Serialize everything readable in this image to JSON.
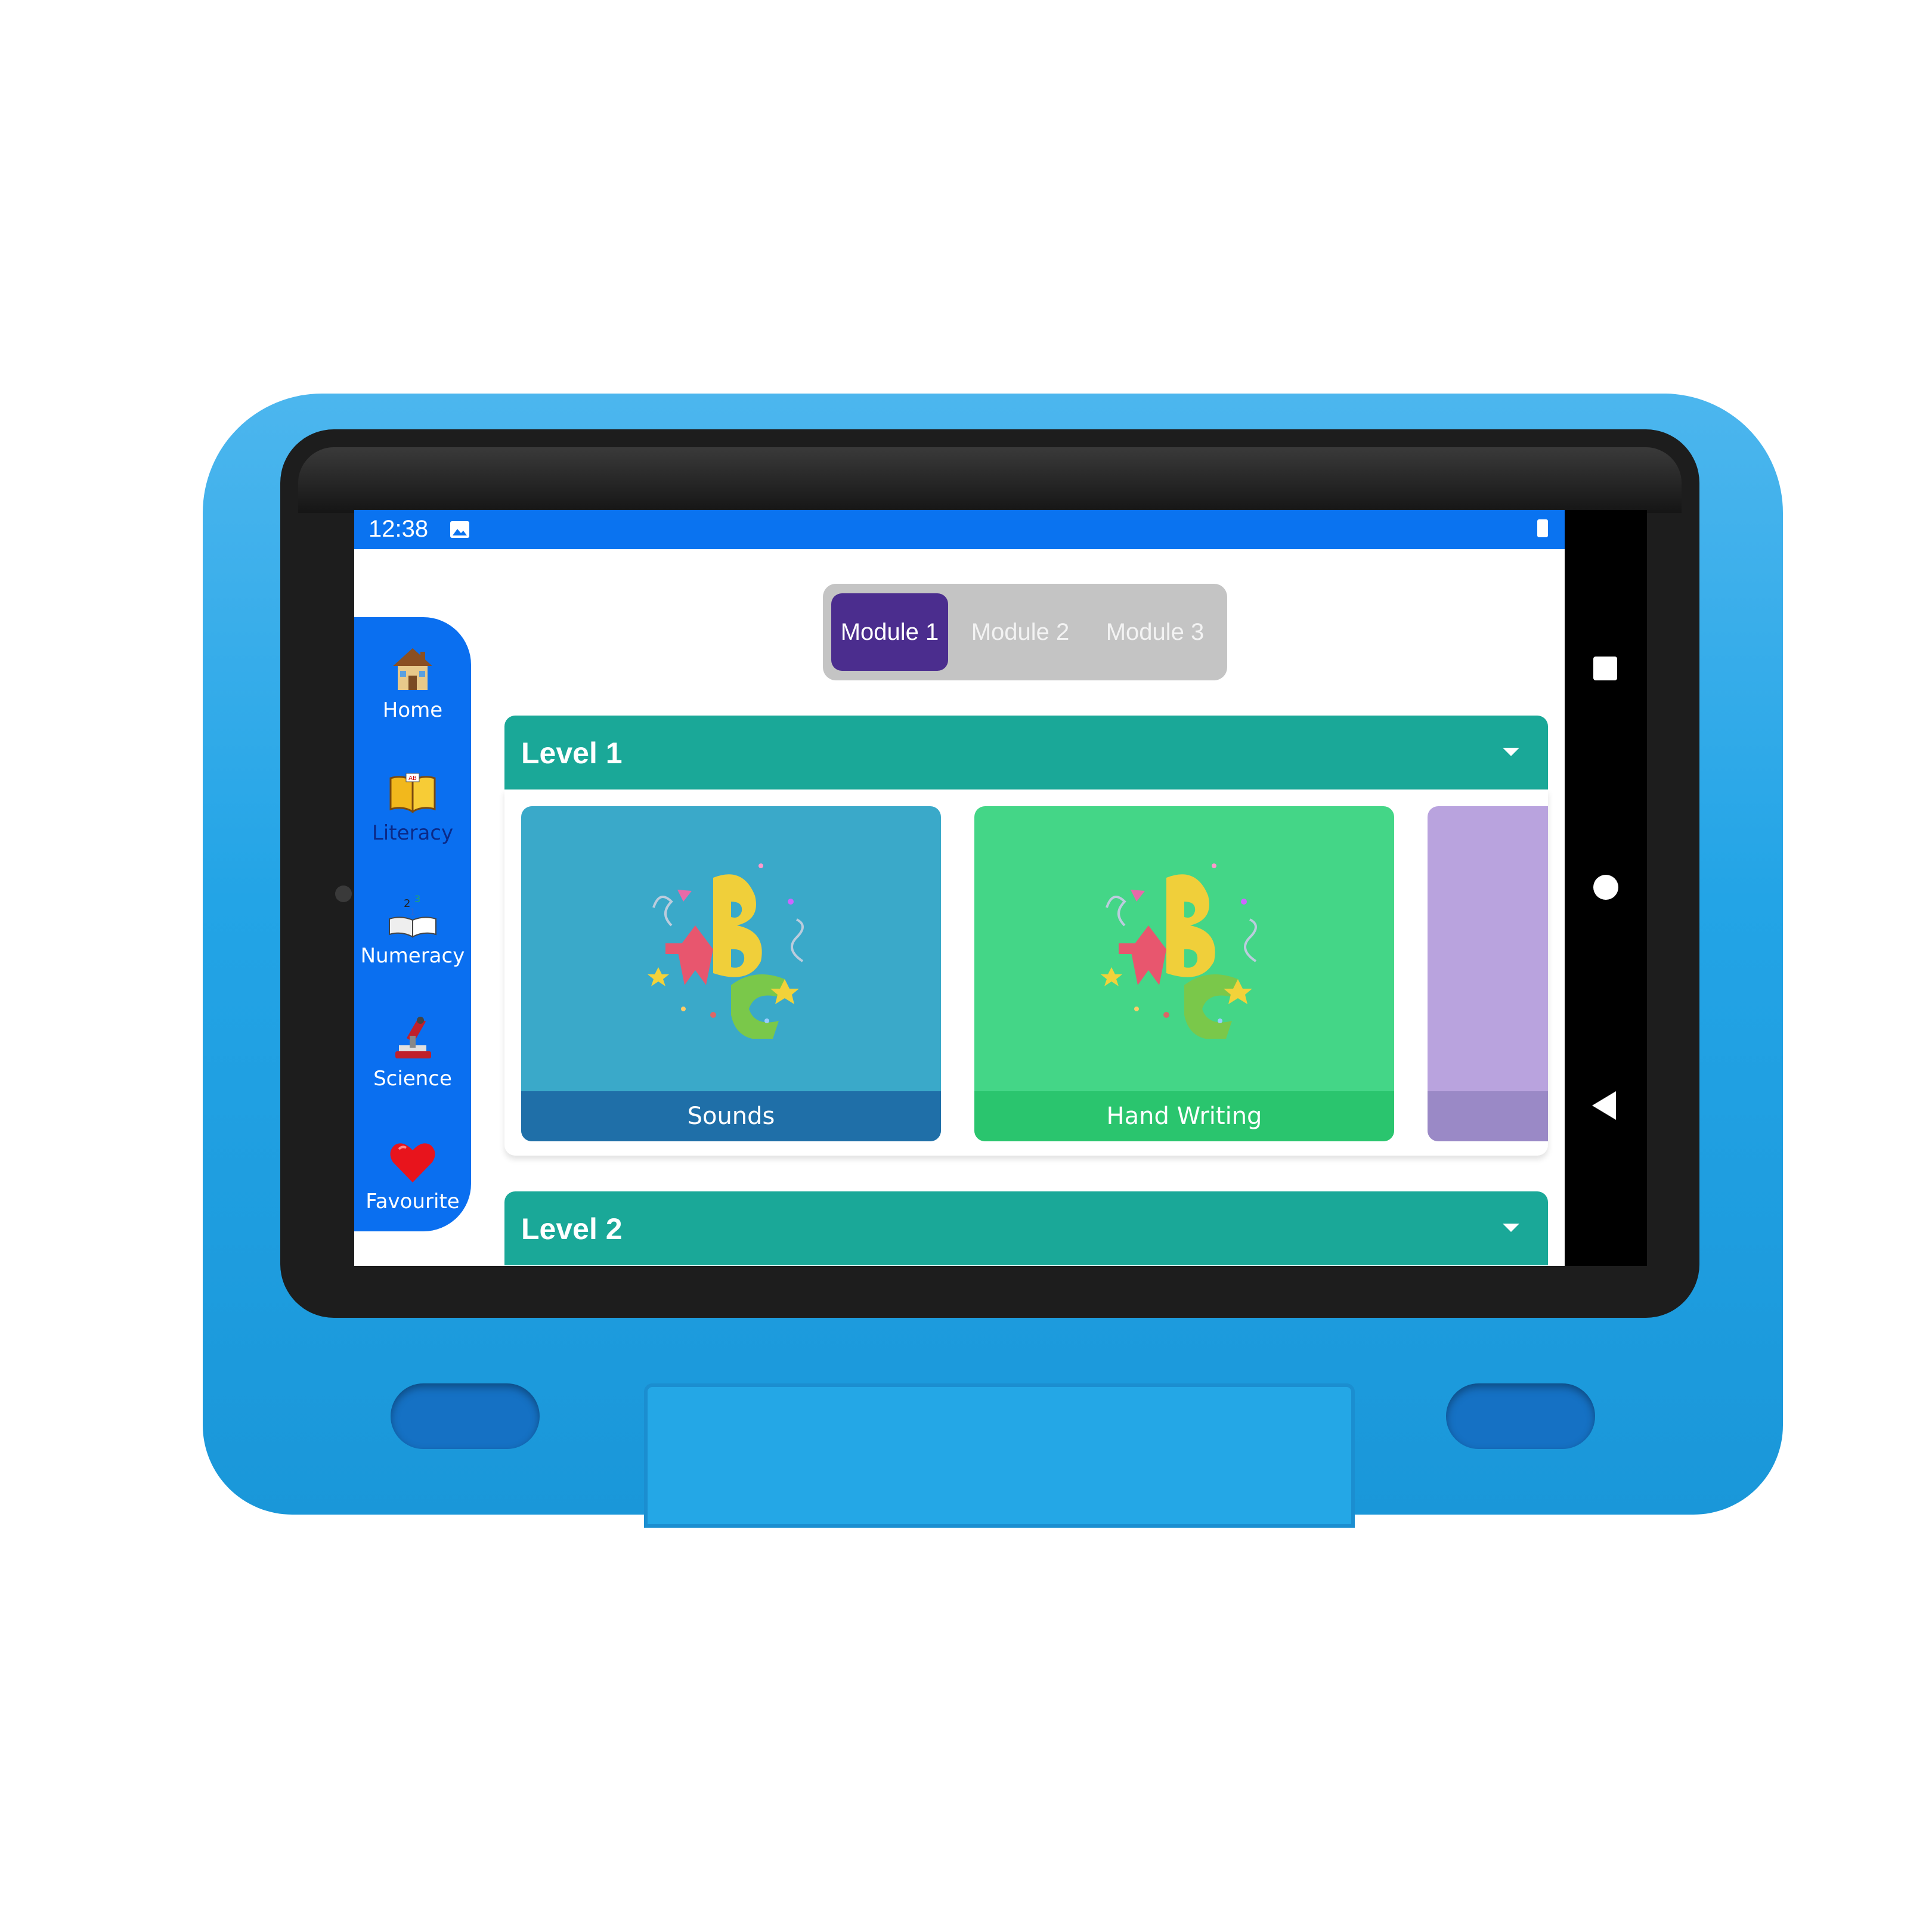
{
  "status_bar": {
    "time": "12:38",
    "icons": [
      "image-icon",
      "battery-icon"
    ]
  },
  "system_nav": {
    "buttons": [
      "recents-square-icon",
      "home-circle-icon",
      "back-triangle-icon"
    ]
  },
  "sidebar": {
    "items": [
      {
        "label": "Home",
        "icon": "house-icon"
      },
      {
        "label": "Literacy",
        "icon": "book-icon"
      },
      {
        "label": "Numeracy",
        "icon": "numbers-book-icon"
      },
      {
        "label": "Science",
        "icon": "microscope-icon"
      },
      {
        "label": "Favourite",
        "icon": "heart-icon"
      }
    ]
  },
  "module_tabs": {
    "selected": "Module 1",
    "tabs": [
      "Module 1",
      "Module 2",
      "Module 3"
    ]
  },
  "levels": [
    {
      "title": "Level 1",
      "expanded": true,
      "cards": [
        {
          "label": "Sounds",
          "icon": "abc-letters-icon"
        },
        {
          "label": "Hand Writing",
          "icon": "abc-letters-icon"
        },
        {
          "label": "",
          "icon": ""
        }
      ]
    },
    {
      "title": "Level 2",
      "expanded": false
    }
  ],
  "colors": {
    "status_bar": "#0a73f0",
    "sidebar": "#0a6ff0",
    "tab_active": "#4b2d8e",
    "level_header": "#1aa898",
    "card_sounds": "#3aa9c9",
    "card_sounds_footer": "#1f6fa8",
    "card_handwriting": "#44d687",
    "card_handwriting_footer": "#2ac56e",
    "card_third": "#b9a3de",
    "card_third_footer": "#9a89c6",
    "case": "#23a4e6"
  }
}
